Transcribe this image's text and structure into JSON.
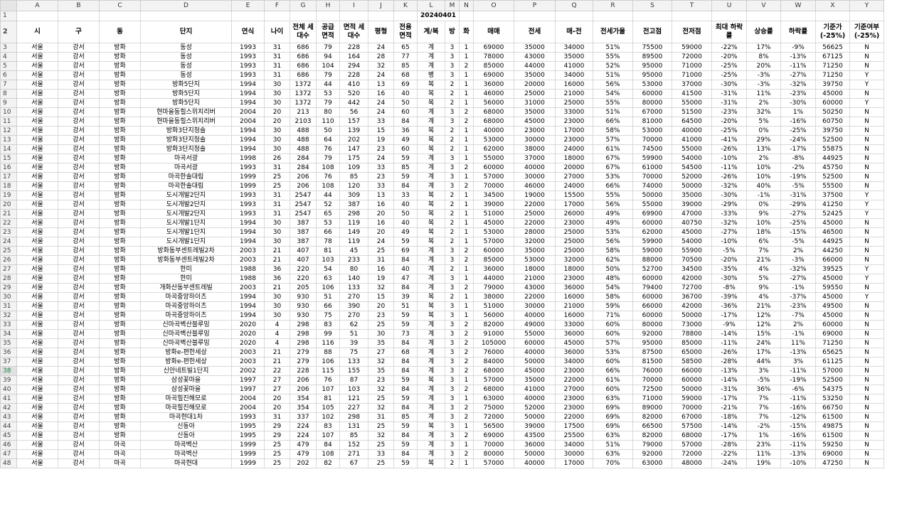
{
  "columns": [
    "A",
    "B",
    "C",
    "D",
    "E",
    "F",
    "G",
    "H",
    "I",
    "J",
    "K",
    "L",
    "M",
    "N",
    "O",
    "P",
    "Q",
    "R",
    "S",
    "T",
    "U",
    "V",
    "W",
    "X",
    "Y"
  ],
  "date_label": "20240401",
  "headers": [
    "시",
    "구",
    "동",
    "단지",
    "연식",
    "나이",
    "전체 세대수",
    "공급 면적",
    "면적 세대수",
    "평형",
    "전용 면적",
    "계/복",
    "방",
    "화",
    "매매",
    "전세",
    "매-전",
    "전세가율",
    "전고점",
    "전저점",
    "최대 하락률",
    "상승률",
    "하락률",
    "기준가 (-25%)",
    "기준여부 (-25%)"
  ],
  "rows": [
    [
      "3",
      [
        "서울",
        "강서",
        "방화",
        "동성",
        "1993",
        "31",
        "686",
        "79",
        "228",
        "24",
        "65",
        "계",
        "3",
        "1",
        "69000",
        "35000",
        "34000",
        "51%",
        "75500",
        "59000",
        "-22%",
        "17%",
        "-9%",
        "56625",
        "N"
      ]
    ],
    [
      "4",
      [
        "서울",
        "강서",
        "방화",
        "동성",
        "1993",
        "31",
        "686",
        "94",
        "164",
        "28",
        "77",
        "계",
        "3",
        "1",
        "78000",
        "43000",
        "35000",
        "55%",
        "89500",
        "72000",
        "-20%",
        "8%",
        "-13%",
        "67125",
        "N"
      ]
    ],
    [
      "5",
      [
        "서울",
        "강서",
        "방화",
        "동성",
        "1993",
        "31",
        "686",
        "104",
        "294",
        "32",
        "85",
        "계",
        "3",
        "2",
        "85000",
        "44000",
        "41000",
        "52%",
        "95000",
        "71000",
        "-25%",
        "20%",
        "-11%",
        "71250",
        "N"
      ]
    ],
    [
      "6",
      [
        "서울",
        "강서",
        "방화",
        "동성",
        "1993",
        "31",
        "686",
        "79",
        "228",
        "24",
        "68",
        "병",
        "3",
        "1",
        "69000",
        "35000",
        "34000",
        "51%",
        "95000",
        "71000",
        "-25%",
        "-3%",
        "-27%",
        "71250",
        "Y"
      ]
    ],
    [
      "7",
      [
        "서울",
        "강서",
        "방화",
        "방화5단지",
        "1994",
        "30",
        "1372",
        "44",
        "410",
        "13",
        "69",
        "복",
        "2",
        "1",
        "36000",
        "20000",
        "16000",
        "56%",
        "53000",
        "37000",
        "-30%",
        "-3%",
        "-32%",
        "39750",
        "Y"
      ]
    ],
    [
      "8",
      [
        "서울",
        "강서",
        "방화",
        "방화5단지",
        "1994",
        "30",
        "1372",
        "53",
        "520",
        "16",
        "40",
        "복",
        "2",
        "1",
        "46000",
        "25000",
        "21000",
        "54%",
        "60000",
        "41500",
        "-31%",
        "11%",
        "-23%",
        "45000",
        "N"
      ]
    ],
    [
      "9",
      [
        "서울",
        "강서",
        "방화",
        "방화5단지",
        "1994",
        "30",
        "1372",
        "79",
        "442",
        "24",
        "50",
        "복",
        "2",
        "1",
        "56000",
        "31000",
        "25000",
        "55%",
        "80000",
        "55000",
        "-31%",
        "2%",
        "-30%",
        "60000",
        "Y"
      ]
    ],
    [
      "10",
      [
        "서울",
        "강서",
        "방화",
        "현마을동힐스위치리버",
        "2004",
        "20",
        "213",
        "80",
        "56",
        "24",
        "60",
        "계",
        "3",
        "2",
        "68000",
        "35000",
        "33000",
        "51%",
        "67000",
        "51500",
        "-23%",
        "32%",
        "1%",
        "50250",
        "N"
      ]
    ],
    [
      "11",
      [
        "서울",
        "강서",
        "방화",
        "현마을동힐스위치리버",
        "2004",
        "20",
        "2103",
        "110",
        "157",
        "33",
        "84",
        "계",
        "3",
        "2",
        "68000",
        "45000",
        "23000",
        "66%",
        "81000",
        "64500",
        "-20%",
        "5%",
        "-16%",
        "60750",
        "N"
      ]
    ],
    [
      "12",
      [
        "서울",
        "강서",
        "방화",
        "방화3단지청솔",
        "1994",
        "30",
        "488",
        "50",
        "139",
        "15",
        "36",
        "복",
        "2",
        "1",
        "40000",
        "23000",
        "17000",
        "58%",
        "53000",
        "40000",
        "-25%",
        "0%",
        "-25%",
        "39750",
        "N"
      ]
    ],
    [
      "13",
      [
        "서울",
        "강서",
        "방화",
        "방화3단지청솔",
        "1994",
        "30",
        "488",
        "64",
        "202",
        "19",
        "49",
        "복",
        "2",
        "1",
        "53000",
        "30000",
        "23000",
        "57%",
        "70000",
        "41000",
        "-41%",
        "29%",
        "-24%",
        "52500",
        "N"
      ]
    ],
    [
      "14",
      [
        "서울",
        "강서",
        "방화",
        "방화3단지청솔",
        "1994",
        "30",
        "488",
        "76",
        "147",
        "23",
        "60",
        "복",
        "2",
        "1",
        "62000",
        "38000",
        "24000",
        "61%",
        "74500",
        "55000",
        "-26%",
        "13%",
        "-17%",
        "55875",
        "N"
      ]
    ],
    [
      "15",
      [
        "서울",
        "강서",
        "방화",
        "마곡서광",
        "1998",
        "26",
        "284",
        "79",
        "175",
        "24",
        "59",
        "계",
        "3",
        "1",
        "55000",
        "37000",
        "18000",
        "67%",
        "59900",
        "54000",
        "-10%",
        "2%",
        "-8%",
        "44925",
        "N"
      ]
    ],
    [
      "16",
      [
        "서울",
        "강서",
        "방화",
        "마곡서광",
        "1993",
        "31",
        "284",
        "108",
        "109",
        "33",
        "85",
        "계",
        "3",
        "2",
        "60000",
        "40000",
        "20000",
        "67%",
        "61000",
        "54500",
        "-11%",
        "10%",
        "-2%",
        "45750",
        "N"
      ]
    ],
    [
      "17",
      [
        "서울",
        "강서",
        "방화",
        "마곡한솔대림",
        "1999",
        "25",
        "206",
        "76",
        "85",
        "23",
        "59",
        "계",
        "3",
        "1",
        "57000",
        "30000",
        "27000",
        "53%",
        "70000",
        "52000",
        "-26%",
        "10%",
        "-19%",
        "52500",
        "N"
      ]
    ],
    [
      "18",
      [
        "서울",
        "강서",
        "방화",
        "마곡한솔대림",
        "1999",
        "25",
        "206",
        "108",
        "120",
        "33",
        "84",
        "계",
        "3",
        "2",
        "70000",
        "46000",
        "24000",
        "66%",
        "74000",
        "50000",
        "-32%",
        "40%",
        "-5%",
        "55500",
        "N"
      ]
    ],
    [
      "19",
      [
        "서울",
        "강서",
        "방화",
        "도시개발2단지",
        "1993",
        "31",
        "2547",
        "44",
        "309",
        "13",
        "33",
        "복",
        "2",
        "1",
        "34500",
        "19000",
        "15500",
        "55%",
        "50000",
        "35000",
        "-30%",
        "-1%",
        "-31%",
        "37500",
        "Y"
      ]
    ],
    [
      "20",
      [
        "서울",
        "강서",
        "방화",
        "도시개발2단지",
        "1993",
        "31",
        "2547",
        "52",
        "387",
        "16",
        "40",
        "복",
        "2",
        "1",
        "39000",
        "22000",
        "17000",
        "56%",
        "55000",
        "39000",
        "-29%",
        "0%",
        "-29%",
        "41250",
        "Y"
      ]
    ],
    [
      "21",
      [
        "서울",
        "강서",
        "방화",
        "도시개발2단지",
        "1993",
        "31",
        "2547",
        "65",
        "298",
        "20",
        "50",
        "복",
        "2",
        "1",
        "51000",
        "25000",
        "26000",
        "49%",
        "69900",
        "47000",
        "-33%",
        "9%",
        "-27%",
        "52425",
        "Y"
      ]
    ],
    [
      "22",
      [
        "서울",
        "강서",
        "방화",
        "도시개발1단지",
        "1994",
        "30",
        "387",
        "53",
        "119",
        "16",
        "40",
        "복",
        "2",
        "1",
        "45000",
        "22000",
        "23000",
        "49%",
        "60000",
        "40750",
        "-32%",
        "10%",
        "-25%",
        "45000",
        "N"
      ]
    ],
    [
      "23",
      [
        "서울",
        "강서",
        "방화",
        "도시개발1단지",
        "1994",
        "30",
        "387",
        "66",
        "149",
        "20",
        "49",
        "복",
        "2",
        "1",
        "53000",
        "28000",
        "25000",
        "53%",
        "62000",
        "45000",
        "-27%",
        "18%",
        "-15%",
        "46500",
        "N"
      ]
    ],
    [
      "24",
      [
        "서울",
        "강서",
        "방화",
        "도시개발1단지",
        "1994",
        "30",
        "387",
        "78",
        "119",
        "24",
        "59",
        "복",
        "2",
        "1",
        "57000",
        "32000",
        "25000",
        "56%",
        "59900",
        "54000",
        "-10%",
        "6%",
        "-5%",
        "44925",
        "N"
      ]
    ],
    [
      "25",
      [
        "서울",
        "강서",
        "방화",
        "방화동부센트레빌2차",
        "2003",
        "21",
        "407",
        "81",
        "45",
        "25",
        "69",
        "계",
        "3",
        "2",
        "60000",
        "35000",
        "25000",
        "58%",
        "59000",
        "55900",
        "-5%",
        "7%",
        "2%",
        "44250",
        "N"
      ]
    ],
    [
      "26",
      [
        "서울",
        "강서",
        "방화",
        "방화동부센트레빌2차",
        "2003",
        "21",
        "407",
        "103",
        "233",
        "31",
        "84",
        "계",
        "3",
        "2",
        "85000",
        "53000",
        "32000",
        "62%",
        "88000",
        "70500",
        "-20%",
        "21%",
        "-3%",
        "66000",
        "N"
      ]
    ],
    [
      "27",
      [
        "서울",
        "강서",
        "방화",
        "한미",
        "1988",
        "36",
        "220",
        "54",
        "80",
        "16",
        "40",
        "계",
        "2",
        "1",
        "36000",
        "18000",
        "18000",
        "50%",
        "52700",
        "34500",
        "-35%",
        "4%",
        "-32%",
        "39525",
        "Y"
      ]
    ],
    [
      "28",
      [
        "서울",
        "강서",
        "방화",
        "한미",
        "1988",
        "36",
        "220",
        "63",
        "140",
        "19",
        "47",
        "계",
        "3",
        "1",
        "44000",
        "21000",
        "23000",
        "48%",
        "60000",
        "42000",
        "-30%",
        "5%",
        "-27%",
        "45000",
        "Y"
      ]
    ],
    [
      "29",
      [
        "서울",
        "강서",
        "방화",
        "개화산동부센트레빌",
        "2003",
        "21",
        "205",
        "106",
        "133",
        "32",
        "84",
        "계",
        "3",
        "2",
        "79000",
        "43000",
        "36000",
        "54%",
        "79400",
        "72700",
        "-8%",
        "9%",
        "-1%",
        "59550",
        "N"
      ]
    ],
    [
      "30",
      [
        "서울",
        "강서",
        "방화",
        "마곡중앙하이츠",
        "1994",
        "30",
        "930",
        "51",
        "270",
        "15",
        "39",
        "복",
        "2",
        "1",
        "38000",
        "22000",
        "16000",
        "58%",
        "60000",
        "36700",
        "-39%",
        "4%",
        "-37%",
        "45000",
        "Y"
      ]
    ],
    [
      "31",
      [
        "서울",
        "강서",
        "방화",
        "마곡중앙하이츠",
        "1994",
        "30",
        "930",
        "66",
        "390",
        "20",
        "51",
        "복",
        "3",
        "1",
        "51000",
        "30000",
        "21000",
        "59%",
        "66000",
        "42000",
        "-36%",
        "21%",
        "-23%",
        "49500",
        "N"
      ]
    ],
    [
      "32",
      [
        "서울",
        "강서",
        "방화",
        "마곡중앙하이츠",
        "1994",
        "30",
        "930",
        "75",
        "270",
        "23",
        "59",
        "복",
        "3",
        "1",
        "56000",
        "40000",
        "16000",
        "71%",
        "60000",
        "50000",
        "-17%",
        "12%",
        "-7%",
        "45000",
        "N"
      ]
    ],
    [
      "33",
      [
        "서울",
        "강서",
        "방화",
        "신마곡벽산블루밍",
        "2020",
        "4",
        "298",
        "83",
        "62",
        "25",
        "59",
        "계",
        "3",
        "2",
        "82000",
        "49000",
        "33000",
        "60%",
        "80000",
        "73000",
        "-9%",
        "12%",
        "2%",
        "60000",
        "N"
      ]
    ],
    [
      "34",
      [
        "서울",
        "강서",
        "방화",
        "신마곡벽산블루밍",
        "2020",
        "4",
        "298",
        "99",
        "51",
        "30",
        "73",
        "계",
        "3",
        "2",
        "91000",
        "55000",
        "36000",
        "60%",
        "92000",
        "78800",
        "-14%",
        "15%",
        "-1%",
        "69000",
        "N"
      ]
    ],
    [
      "35",
      [
        "서울",
        "강서",
        "방화",
        "신마곡벽산블루밍",
        "2020",
        "4",
        "298",
        "116",
        "39",
        "35",
        "84",
        "계",
        "3",
        "2",
        "105000",
        "60000",
        "45000",
        "57%",
        "95000",
        "85000",
        "-11%",
        "24%",
        "11%",
        "71250",
        "N"
      ]
    ],
    [
      "36",
      [
        "서울",
        "강서",
        "방화",
        "방화e-편한세상",
        "2003",
        "21",
        "279",
        "88",
        "75",
        "27",
        "68",
        "계",
        "3",
        "2",
        "76000",
        "40000",
        "36000",
        "53%",
        "87500",
        "65000",
        "-26%",
        "17%",
        "-13%",
        "65625",
        "N"
      ]
    ],
    [
      "37",
      [
        "서울",
        "강서",
        "방화",
        "방화e-편한세상",
        "2003",
        "21",
        "279",
        "106",
        "133",
        "32",
        "84",
        "계",
        "3",
        "2",
        "84000",
        "50000",
        "34000",
        "60%",
        "81500",
        "58500",
        "-28%",
        "44%",
        "3%",
        "61125",
        "N"
      ]
    ],
    [
      "38",
      [
        "서울",
        "강서",
        "방화",
        "신안네트빌1단지",
        "2002",
        "22",
        "228",
        "115",
        "155",
        "35",
        "84",
        "계",
        "3",
        "2",
        "68000",
        "45000",
        "23000",
        "66%",
        "76000",
        "66000",
        "-13%",
        "3%",
        "-11%",
        "57000",
        "N"
      ]
    ],
    [
      "39",
      [
        "서울",
        "강서",
        "방화",
        "삼성꽃마을",
        "1997",
        "27",
        "206",
        "76",
        "87",
        "23",
        "59",
        "복",
        "3",
        "1",
        "57000",
        "35000",
        "22000",
        "61%",
        "70000",
        "60000",
        "-14%",
        "-5%",
        "-19%",
        "52500",
        "N"
      ]
    ],
    [
      "40",
      [
        "서울",
        "강서",
        "방화",
        "삼성꽃마을",
        "1997",
        "27",
        "206",
        "107",
        "103",
        "32",
        "84",
        "계",
        "3",
        "2",
        "68000",
        "41000",
        "27000",
        "60%",
        "72500",
        "50000",
        "-31%",
        "36%",
        "-6%",
        "54375",
        "N"
      ]
    ],
    [
      "41",
      [
        "서울",
        "강서",
        "방화",
        "마곡힐진해모로",
        "2004",
        "20",
        "354",
        "81",
        "121",
        "25",
        "59",
        "계",
        "3",
        "1",
        "63000",
        "40000",
        "23000",
        "63%",
        "71000",
        "59000",
        "-17%",
        "7%",
        "-11%",
        "53250",
        "N"
      ]
    ],
    [
      "42",
      [
        "서울",
        "강서",
        "방화",
        "마곡힐진해모로",
        "2004",
        "20",
        "354",
        "105",
        "227",
        "32",
        "84",
        "계",
        "3",
        "2",
        "75000",
        "52000",
        "23000",
        "69%",
        "89000",
        "70000",
        "-21%",
        "7%",
        "-16%",
        "66750",
        "N"
      ]
    ],
    [
      "43",
      [
        "서울",
        "강서",
        "방화",
        "마곡현대1차",
        "1993",
        "31",
        "337",
        "102",
        "298",
        "31",
        "85",
        "계",
        "3",
        "2",
        "72000",
        "50000",
        "22000",
        "69%",
        "82000",
        "67000",
        "-18%",
        "7%",
        "-12%",
        "61500",
        "N"
      ]
    ],
    [
      "44",
      [
        "서울",
        "강서",
        "방화",
        "신동아",
        "1995",
        "29",
        "224",
        "83",
        "131",
        "25",
        "59",
        "복",
        "3",
        "1",
        "56500",
        "39000",
        "17500",
        "69%",
        "66500",
        "57500",
        "-14%",
        "-2%",
        "-15%",
        "49875",
        "N"
      ]
    ],
    [
      "45",
      [
        "서울",
        "강서",
        "방화",
        "신동아",
        "1995",
        "29",
        "224",
        "107",
        "85",
        "32",
        "84",
        "계",
        "3",
        "2",
        "69000",
        "43500",
        "25500",
        "63%",
        "82000",
        "68000",
        "-17%",
        "1%",
        "-16%",
        "61500",
        "N"
      ]
    ],
    [
      "46",
      [
        "서울",
        "강서",
        "마곡",
        "마곡벽산",
        "1999",
        "25",
        "479",
        "84",
        "152",
        "25",
        "59",
        "계",
        "3",
        "1",
        "70000",
        "36000",
        "34000",
        "51%",
        "79000",
        "57000",
        "-28%",
        "23%",
        "-11%",
        "59250",
        "N"
      ]
    ],
    [
      "47",
      [
        "서울",
        "강서",
        "마곡",
        "마곡벽산",
        "1999",
        "25",
        "479",
        "108",
        "271",
        "33",
        "84",
        "계",
        "3",
        "2",
        "80000",
        "50000",
        "30000",
        "63%",
        "92000",
        "72000",
        "-22%",
        "11%",
        "-13%",
        "69000",
        "N"
      ]
    ],
    [
      "48",
      [
        "서울",
        "강서",
        "마곡",
        "마곡현대",
        "1999",
        "25",
        "202",
        "82",
        "67",
        "25",
        "59",
        "복",
        "2",
        "1",
        "57000",
        "40000",
        "17000",
        "70%",
        "63000",
        "48000",
        "-24%",
        "19%",
        "-10%",
        "47250",
        "N"
      ]
    ]
  ]
}
